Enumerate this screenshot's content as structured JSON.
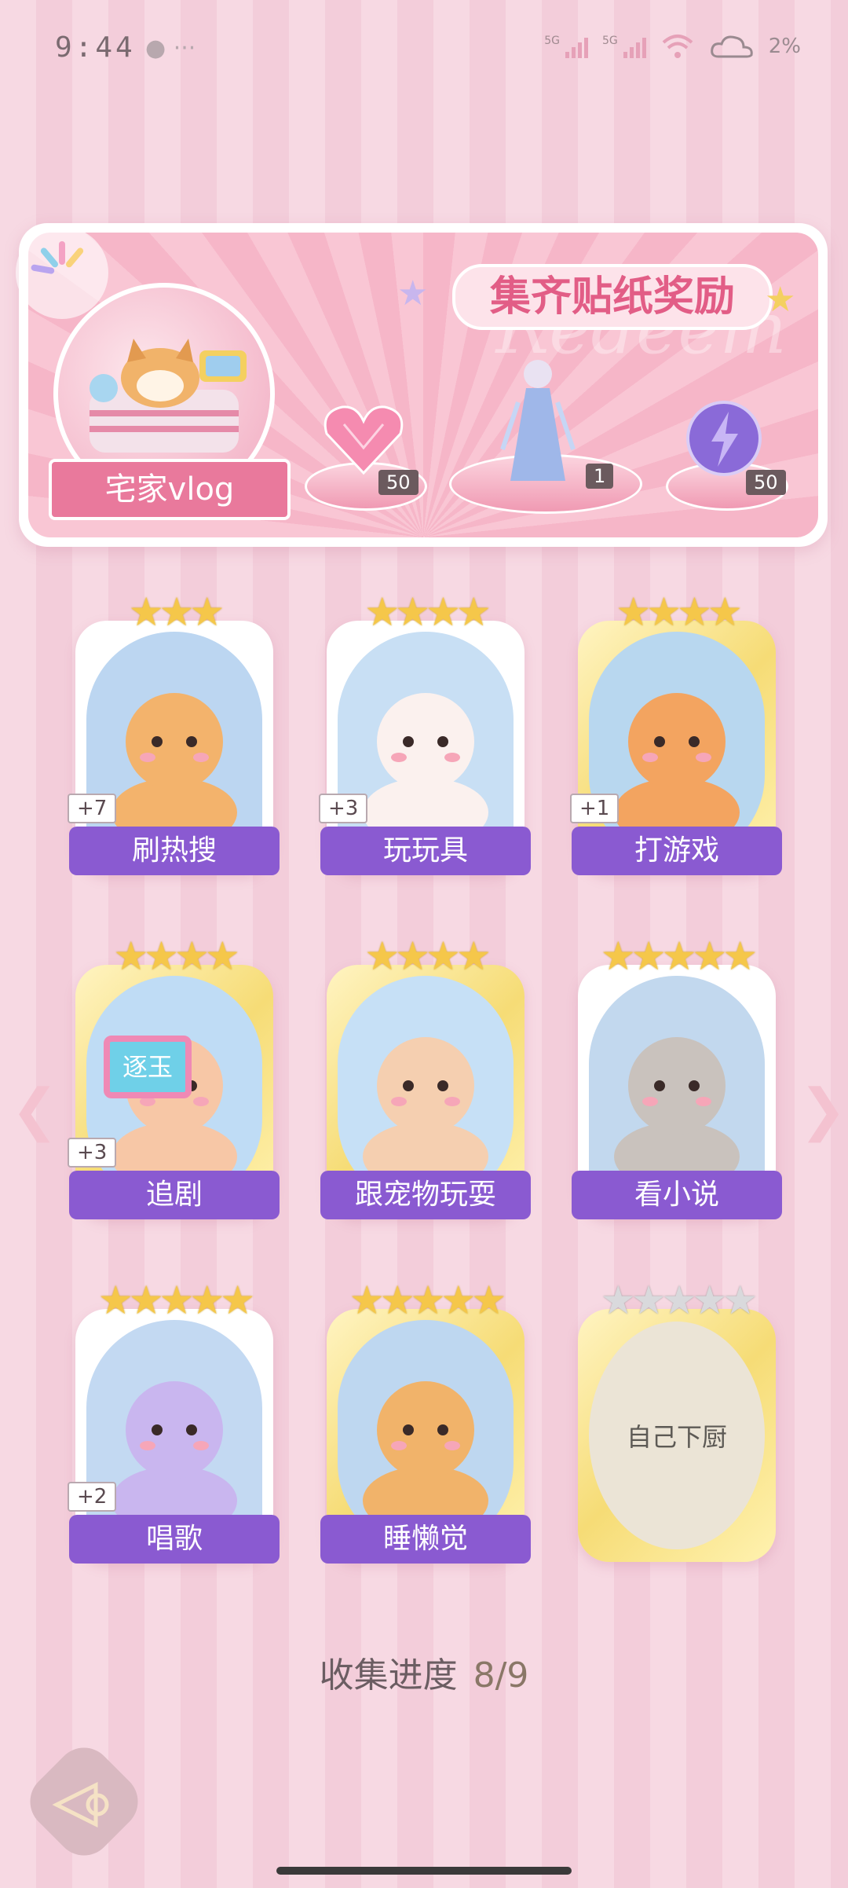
{
  "status_bar": {
    "time": "9:44",
    "dots": "● ···",
    "network": [
      "5G",
      "5G"
    ],
    "battery": "2%"
  },
  "banner": {
    "title": "集齐贴纸奖励",
    "watermark": "Redeem",
    "vlog_label": "宅家vlog",
    "rewards": [
      {
        "name": "heart-gem",
        "count": "50"
      },
      {
        "name": "outfit",
        "count": "1"
      },
      {
        "name": "lightning-orb",
        "count": "50"
      }
    ]
  },
  "cards": [
    {
      "label": "刷热搜",
      "plus": "+7",
      "stars": 3,
      "gold": false
    },
    {
      "label": "玩玩具",
      "plus": "+3",
      "stars": 4,
      "gold": false
    },
    {
      "label": "打游戏",
      "plus": "+1",
      "stars": 4,
      "gold": true
    },
    {
      "label": "追剧",
      "plus": "+3",
      "stars": 4,
      "gold": true
    },
    {
      "label": "跟宠物玩耍",
      "plus": "",
      "stars": 4,
      "gold": true
    },
    {
      "label": "看小说",
      "plus": "",
      "stars": 5,
      "gold": false
    },
    {
      "label": "唱歌",
      "plus": "+2",
      "stars": 5,
      "gold": false
    },
    {
      "label": "睡懒觉",
      "plus": "",
      "stars": 5,
      "gold": true
    },
    {
      "label": "自己下厨",
      "plus": "",
      "stars": 5,
      "gold": true,
      "locked": true
    }
  ],
  "tv_text": "逐玉",
  "progress": {
    "label": "收集进度",
    "value": "8/9"
  }
}
